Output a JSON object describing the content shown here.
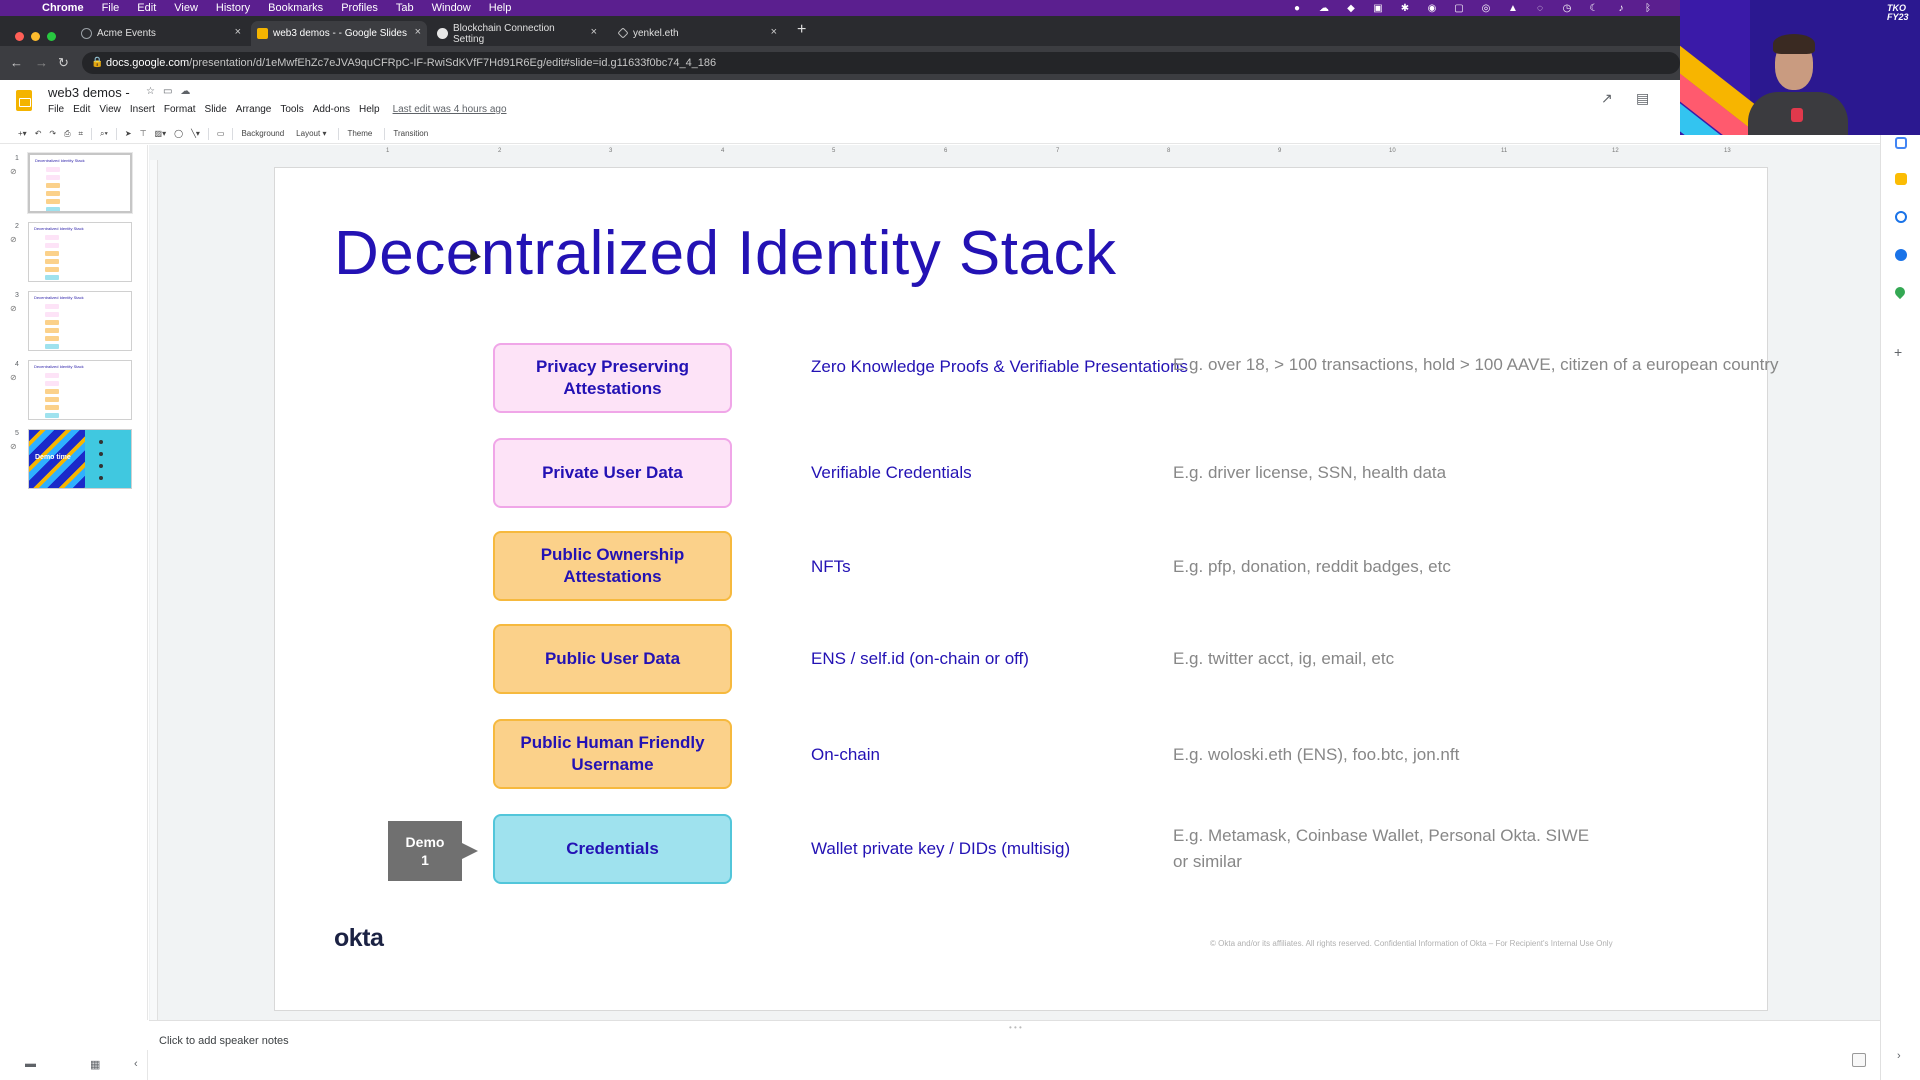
{
  "menubar": {
    "app": "Chrome",
    "items": [
      "File",
      "Edit",
      "View",
      "History",
      "Bookmarks",
      "Profiles",
      "Tab",
      "Window",
      "Help"
    ]
  },
  "browser": {
    "tabs": [
      {
        "title": "Acme Events",
        "active": false
      },
      {
        "title": "web3 demos - - Google Slides",
        "active": true
      },
      {
        "title": "Blockchain Connection Setting",
        "active": false
      },
      {
        "title": "yenkel.eth",
        "active": false
      }
    ],
    "url_host": "docs.google.com",
    "url_path": "/presentation/d/1eMwfEhZc7eJVA9quCFRpC-IF-RwiSdKVfF7Hd91R6Eg/edit#slide=id.g11633f0bc74_4_186"
  },
  "doc": {
    "title": "web3 demos -",
    "menu": [
      "File",
      "Edit",
      "View",
      "Insert",
      "Format",
      "Slide",
      "Arrange",
      "Tools",
      "Add-ons",
      "Help"
    ],
    "last_edit": "Last edit was 4 hours ago"
  },
  "toolbar": {
    "background": "Background",
    "layout": "Layout",
    "theme": "Theme",
    "transition": "Transition"
  },
  "filmstrip": {
    "numbers": [
      "1",
      "2",
      "3",
      "4",
      "5"
    ],
    "thumb_title": "Decentralized Identity Stack",
    "thumb5_label": "Demo time"
  },
  "ruler": [
    "1",
    "2",
    "3",
    "4",
    "5",
    "6",
    "7",
    "8",
    "9",
    "10",
    "11",
    "12",
    "13"
  ],
  "slide": {
    "title": "Decentralized Identity Stack",
    "rows": [
      {
        "box": "Privacy Preserving Attestations",
        "tech": "Zero Knowledge Proofs & Verifiable Presentations",
        "example": "E.g. over 18, > 100 transactions, hold > 100 AAVE, citizen of a european country"
      },
      {
        "box": "Private User Data",
        "tech": "Verifiable Credentials",
        "example": "E.g. driver license, SSN, health data"
      },
      {
        "box": "Public Ownership Attestations",
        "tech": "NFTs",
        "example": "E.g. pfp, donation, reddit badges, etc"
      },
      {
        "box": "Public User Data",
        "tech": "ENS / self.id (on-chain or off)",
        "example": "E.g. twitter acct, ig, email, etc"
      },
      {
        "box": "Public Human Friendly Username",
        "tech": "On-chain",
        "example": "E.g. woloski.eth (ENS), foo.btc, jon.nft"
      },
      {
        "box": "Credentials",
        "tech": "Wallet private key / DIDs (multisig)",
        "example": "E.g. Metamask, Coinbase Wallet, Personal Okta. SIWE or similar"
      }
    ],
    "demo_flag": "Demo 1",
    "logo": "okta",
    "legal": "© Okta and/or its affiliates. All rights reserved. Confidential Information of Okta – For Recipient's Internal Use Only"
  },
  "notes": {
    "placeholder": "Click to add speaker notes"
  },
  "webcam": {
    "tag": "TKO FY23"
  },
  "colors": {
    "title_blue": "#2312b4",
    "pink_fill": "#fde3f7",
    "orange_fill": "#fbd18a",
    "cyan_fill": "#9fe2ee",
    "menubar": "#5b1f8f"
  }
}
